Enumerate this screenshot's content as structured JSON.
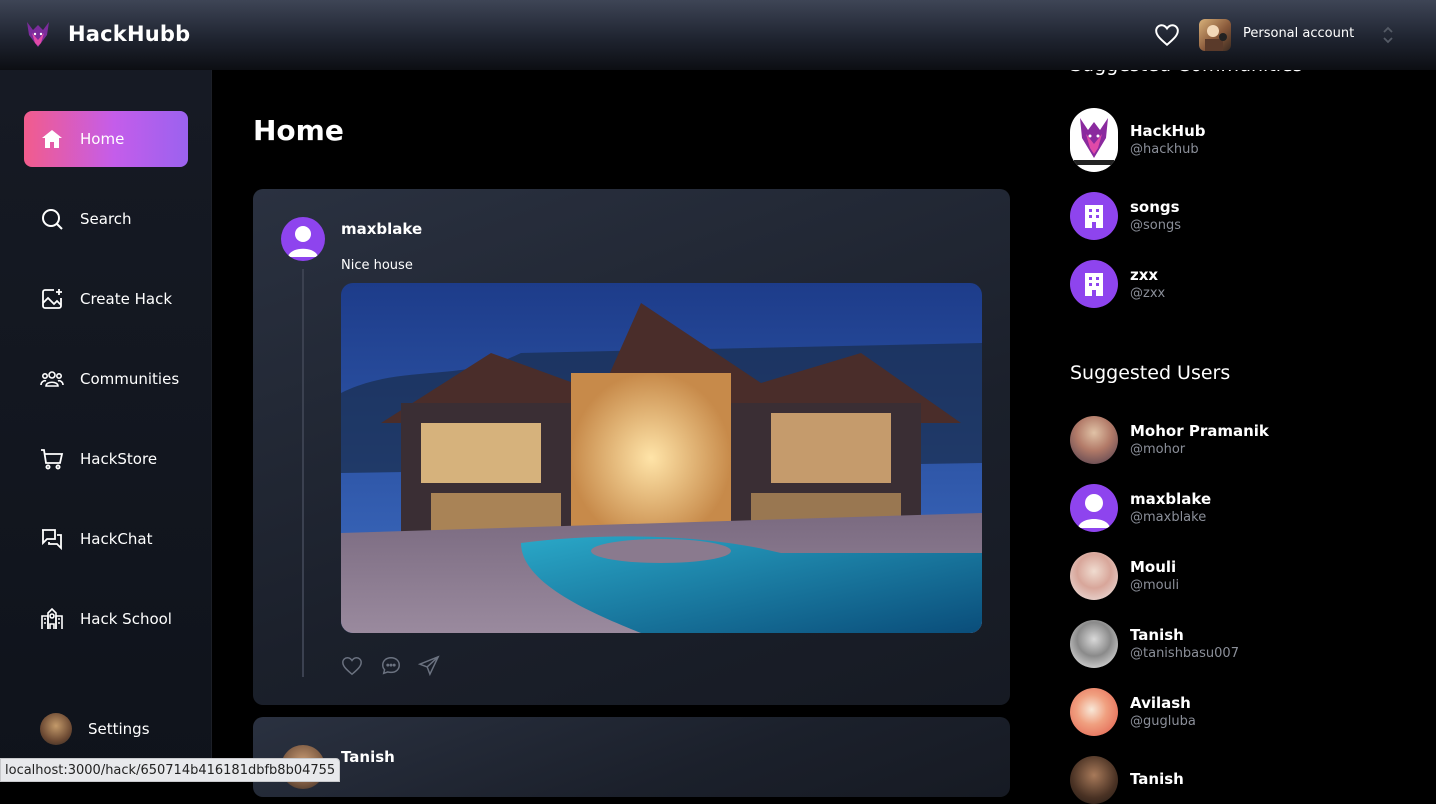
{
  "app": {
    "name": "HackHubb"
  },
  "header": {
    "account_label": "Personal account"
  },
  "sidebar": {
    "items": [
      {
        "label": "Home",
        "icon": "home-icon",
        "active": true
      },
      {
        "label": "Search",
        "icon": "search-icon"
      },
      {
        "label": "Create Hack",
        "icon": "image-plus-icon"
      },
      {
        "label": "Communities",
        "icon": "users-icon"
      },
      {
        "label": "HackStore",
        "icon": "cart-icon"
      },
      {
        "label": "HackChat",
        "icon": "chat-icon"
      },
      {
        "label": "Hack School",
        "icon": "school-icon"
      }
    ],
    "settings_label": "Settings"
  },
  "main": {
    "title": "Home",
    "posts": [
      {
        "author": "maxblake",
        "text": "Nice house"
      },
      {
        "author": "Tanish"
      }
    ]
  },
  "right": {
    "communities_title": "Suggested Communities",
    "communities": [
      {
        "name": "HackHub",
        "handle": "@hackhub"
      },
      {
        "name": "songs",
        "handle": "@songs"
      },
      {
        "name": "zxx",
        "handle": "@zxx"
      }
    ],
    "users_title": "Suggested Users",
    "users": [
      {
        "name": "Mohor Pramanik",
        "handle": "@mohor"
      },
      {
        "name": "maxblake",
        "handle": "@maxblake"
      },
      {
        "name": "Mouli",
        "handle": "@mouli"
      },
      {
        "name": "Tanish",
        "handle": "@tanishbasu007"
      },
      {
        "name": "Avilash",
        "handle": "@gugluba"
      },
      {
        "name": "Tanish"
      }
    ]
  },
  "status_bar": {
    "url": "localhost:3000/hack/650714b416181dbfb8b04755"
  },
  "colors": {
    "accent_start": "#f25c8c",
    "accent_end": "#9b62ef",
    "community_purple": "#8e44ee"
  }
}
